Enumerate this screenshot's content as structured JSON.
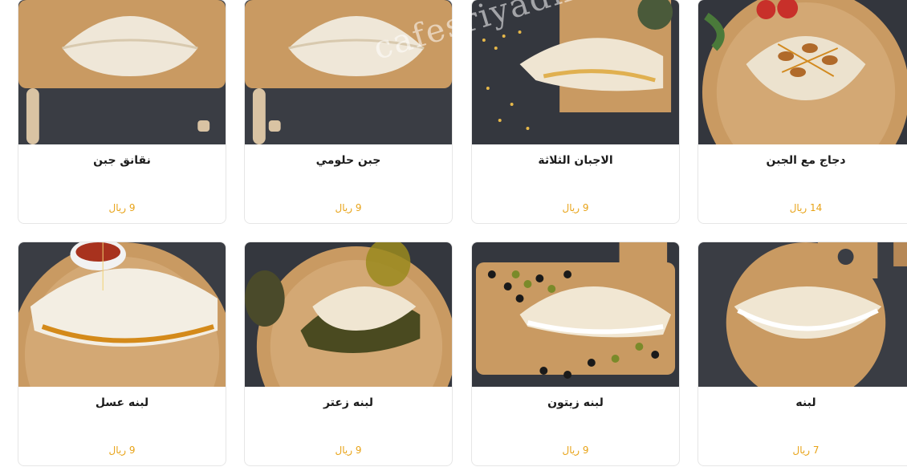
{
  "watermark": "cafesriyadh.com",
  "accent_color": "#e8a317",
  "items": [
    {
      "name": "نقانق جبن",
      "price": "9 ريال",
      "image": "cheese-sausage-saj-photo"
    },
    {
      "name": "جبن حلومي",
      "price": "9 ريال",
      "image": "halloumi-cheese-saj-photo"
    },
    {
      "name": "الاجبان الثلاثة",
      "price": "9 ريال",
      "image": "three-cheese-saj-photo"
    },
    {
      "name": "دجاج مع الجبن",
      "price": "14 ريال",
      "image": "chicken-cheese-saj-photo"
    },
    {
      "name": "لبنه عسل",
      "price": "9 ريال",
      "image": "labneh-honey-saj-photo"
    },
    {
      "name": "لبنه زعتر",
      "price": "9 ريال",
      "image": "labneh-zaatar-saj-photo"
    },
    {
      "name": "لبنه زيتون",
      "price": "9 ريال",
      "image": "labneh-olives-saj-photo"
    },
    {
      "name": "لبنه",
      "price": "7 ريال",
      "image": "labneh-saj-photo"
    }
  ]
}
